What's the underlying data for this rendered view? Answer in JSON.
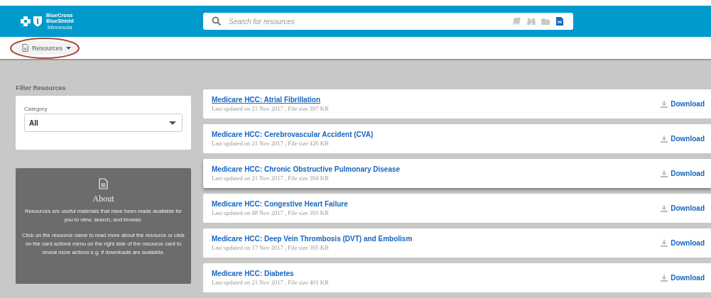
{
  "header": {
    "brand_line_1": "BlueCross",
    "brand_line_2": "BlueShield",
    "brand_region": "Minnesota",
    "search": {
      "placeholder": "Search for resources"
    },
    "type_filters": [
      {
        "kind": "book",
        "selected": false
      },
      {
        "kind": "binoculars",
        "selected": false
      },
      {
        "kind": "folder",
        "selected": false
      },
      {
        "kind": "document",
        "selected": true
      }
    ]
  },
  "nav": {
    "menu_label": "Resources"
  },
  "filter": {
    "heading": "Filter Resources",
    "category_label": "Category",
    "category_value": "All"
  },
  "about": {
    "title": "About",
    "paragraphs": [
      "Resources are useful materials that have been made available for you to view, search, and browse.",
      "Click on the resource name to read more about the resource or click on the card actions menu on the right side of the resource card to reveal more actions e.g. if downloads are available."
    ]
  },
  "resources": [
    {
      "title": "Medicare HCC: Atrial Fibrillation",
      "meta": "Last updated on 21 Nov 2017 , File size 397 KB",
      "action": "Download",
      "underlined": true,
      "raised": false
    },
    {
      "title": "Medicare HCC: Cerebrovascular Accident (CVA)",
      "meta": "Last updated on 21 Nov 2017 , File size 426 KB",
      "action": "Download",
      "underlined": false,
      "raised": false
    },
    {
      "title": "Medicare HCC: Chronic Obstructive Pulmonary Disease",
      "meta": "Last updated on 21 Nov 2017 , File size 394 KB",
      "action": "Download",
      "underlined": false,
      "raised": true
    },
    {
      "title": "Medicare HCC: Congestive Heart Failure",
      "meta": "Last updated on 08 Nov 2017 , File size 393 KB",
      "action": "Download",
      "underlined": false,
      "raised": false
    },
    {
      "title": "Medicare HCC: Deep Vein Thrombosis (DVT) and Embolism",
      "meta": "Last updated on 17 Nov 2017 , File size 395 KB",
      "action": "Download",
      "underlined": false,
      "raised": false
    },
    {
      "title": "Medicare HCC: Diabetes",
      "meta": "Last updated on 21 Nov 2017 , File size 401 KB",
      "action": "Download",
      "underlined": false,
      "raised": false
    }
  ]
}
